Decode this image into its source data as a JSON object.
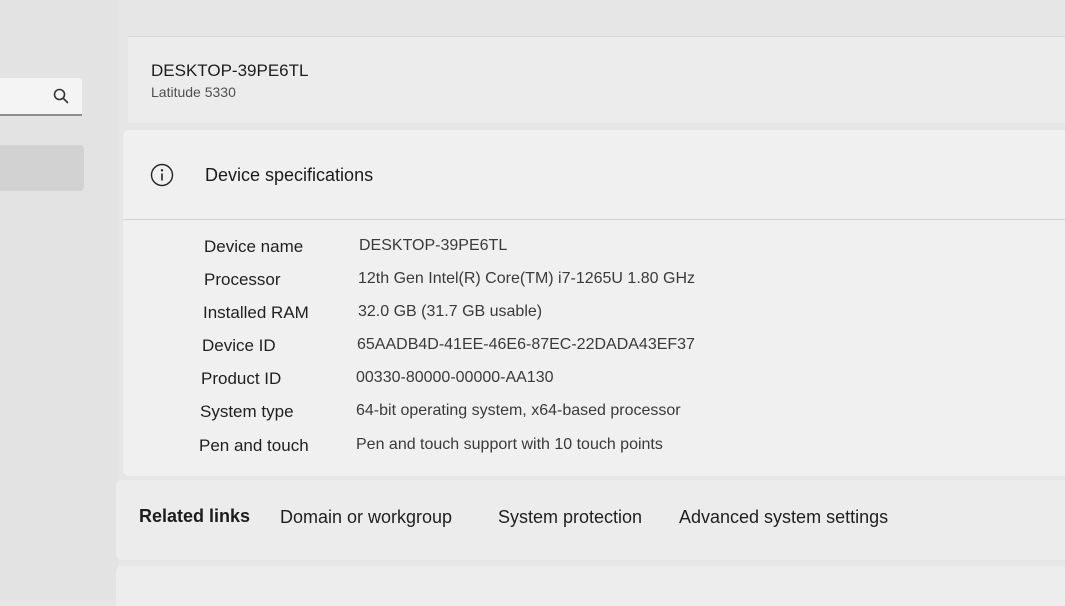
{
  "device": {
    "name": "DESKTOP-39PE6TL",
    "model": "Latitude 5330"
  },
  "specs": {
    "title": "Device specifications",
    "rows": [
      {
        "label": "Device name",
        "value": "DESKTOP-39PE6TL"
      },
      {
        "label": "Processor",
        "value": "12th Gen Intel(R) Core(TM) i7-1265U   1.80 GHz"
      },
      {
        "label": "Installed RAM",
        "value": "32.0 GB (31.7 GB usable)"
      },
      {
        "label": "Device ID",
        "value": "65AADB4D-41EE-46E6-87EC-22DADA43EF37"
      },
      {
        "label": "Product ID",
        "value": "00330-80000-00000-AA130"
      },
      {
        "label": "System type",
        "value": "64-bit operating system, x64-based processor"
      },
      {
        "label": "Pen and touch",
        "value": "Pen and touch support with 10 touch points"
      }
    ]
  },
  "related": {
    "label": "Related links",
    "links": [
      "Domain or workgroup",
      "System protection",
      "Advanced system settings"
    ]
  },
  "icons": {
    "search": "search-icon",
    "info": "info-icon"
  }
}
